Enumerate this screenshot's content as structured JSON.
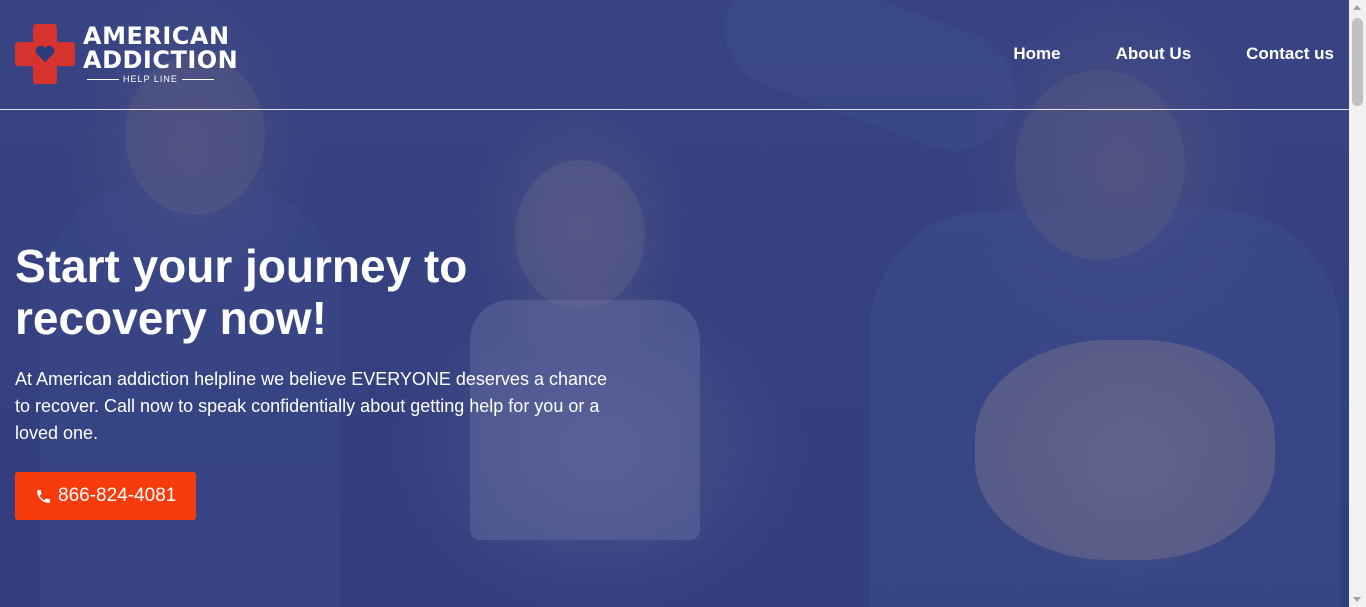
{
  "brand": {
    "line1": "AMERICAN",
    "line2": "ADDICTION",
    "sub": "HELP LINE",
    "logo_icon": "red-cross-heart-icon",
    "cross_color": "#d6322e"
  },
  "nav": {
    "items": [
      {
        "label": "Home"
      },
      {
        "label": "About Us"
      },
      {
        "label": "Contact us"
      }
    ]
  },
  "hero": {
    "headline": "Start your journey to recovery now!",
    "subtext": "At American addiction helpline we believe EVERYONE deserves a chance to recover. Call now to speak confidentially about getting help for you or a loved one.",
    "background_image": "family-celebrating-photo",
    "overlay_color": "#2a3478"
  },
  "cta": {
    "phone": "866-824-4081",
    "icon": "phone-icon",
    "color": "#f73b0c"
  }
}
